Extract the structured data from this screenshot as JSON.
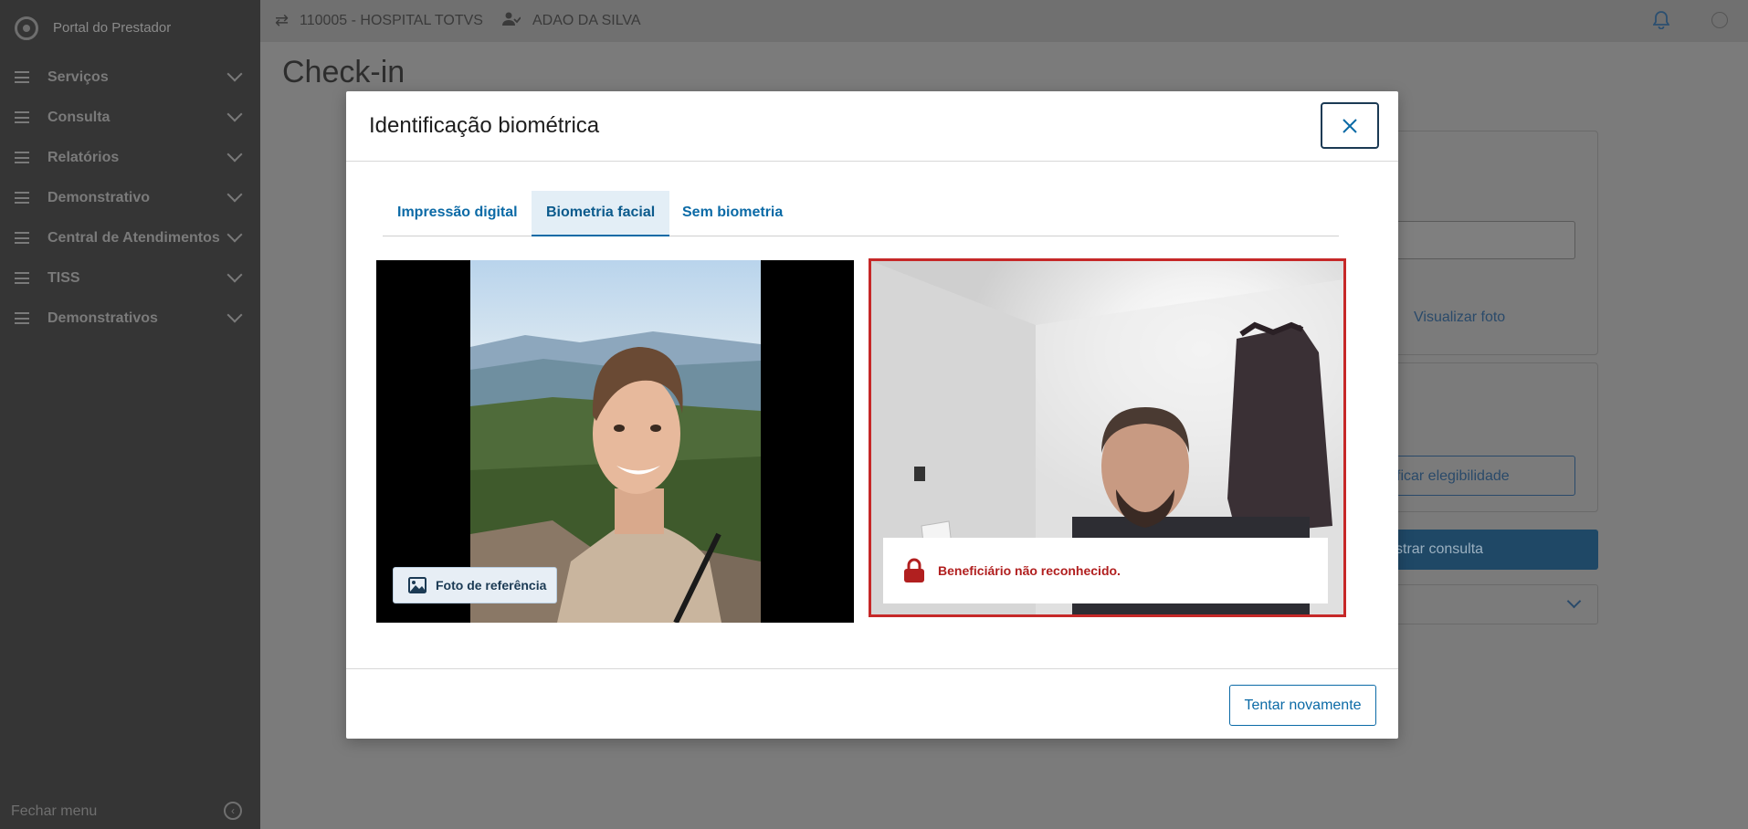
{
  "app": {
    "title": "Portal do Prestador"
  },
  "sidebar": {
    "items": [
      {
        "label": "Serviços"
      },
      {
        "label": "Consulta"
      },
      {
        "label": "Relatórios"
      },
      {
        "label": "Demonstrativo"
      },
      {
        "label": "Central de Atendimentos"
      },
      {
        "label": "TISS"
      },
      {
        "label": "Demonstrativos"
      }
    ],
    "footer_label": "Fechar menu"
  },
  "topbar": {
    "hospital": "110005 - HOSPITAL TOTVS",
    "user": "ADAO DA SILVA"
  },
  "page": {
    "title": "Check-in",
    "visualizar_foto": "Visualizar foto",
    "verificar_partial": "ficar elegibilidade",
    "registrar_partial": "strar consulta"
  },
  "modal": {
    "title": "Identificação biométrica",
    "tabs": [
      {
        "label": "Impressão digital",
        "active": false
      },
      {
        "label": "Biometria facial",
        "active": true
      },
      {
        "label": "Sem biometria",
        "active": false
      }
    ],
    "reference_badge": "Foto de referência",
    "alert_message": "Beneficiário não reconhecido.",
    "retry_button": "Tentar novamente"
  },
  "colors": {
    "primary": "#0b6aa6",
    "error": "#c62828",
    "overlay": "#7b7b7b"
  }
}
